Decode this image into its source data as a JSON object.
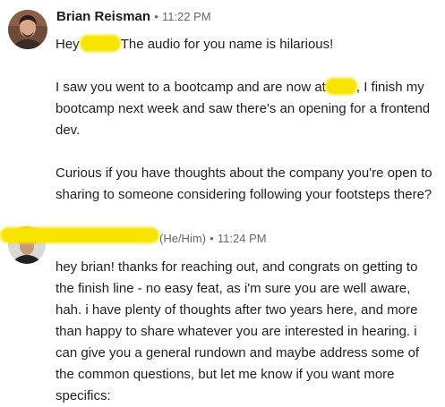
{
  "messages": [
    {
      "sender": "Brian Reisman",
      "separator": "•",
      "time": "11:22 PM",
      "greeting_prefix": "Hey",
      "greeting_suffix": "The audio for you name is hilarious!",
      "para2_prefix": "I saw you went to a bootcamp and are now at",
      "para2_suffix": ", I finish my bootcamp next week and saw there's an opening for a frontend dev.",
      "para3": "Curious if you have thoughts about the company you're open to sharing to someone considering following your footsteps there?"
    },
    {
      "pronouns": "(He/Him)",
      "separator": "•",
      "time": "11:24 PM",
      "body": "hey brian! thanks for reaching out, and congrats on getting to the finish line - no easy feat, as i'm sure you are well aware, hah. i have plenty of thoughts after two years here, and more than happy to share whatever you are interested in hearing. i can give you a general rundown and maybe address some of the common questions, but let me know if you want more specifics:"
    }
  ],
  "colors": {
    "redaction": "#f7e400",
    "meta_text": "#666666"
  }
}
